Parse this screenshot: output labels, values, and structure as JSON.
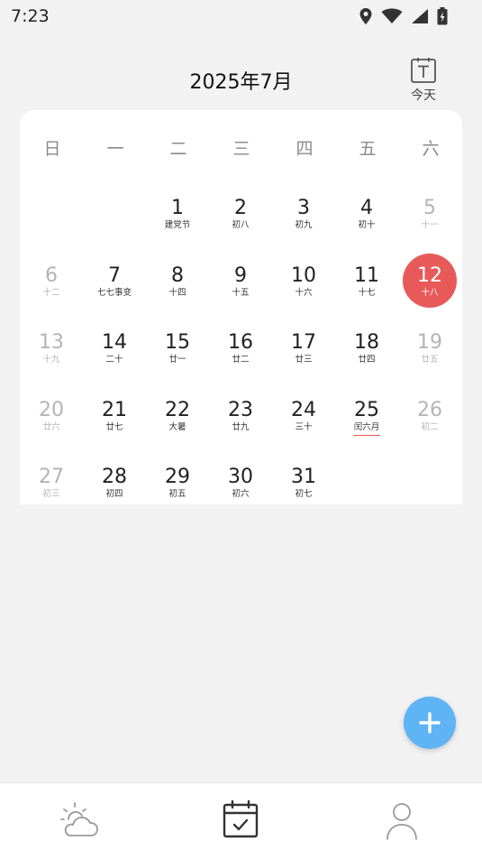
{
  "status_bar": {
    "time": "7:23",
    "icons": [
      "location-icon",
      "wifi-icon",
      "cell-signal-icon",
      "battery-charging-icon"
    ]
  },
  "header": {
    "title": "2025年7月",
    "today_label": "今天",
    "today_icon": "calendar-today-icon"
  },
  "weekdays": [
    "日",
    "一",
    "二",
    "三",
    "四",
    "五",
    "六"
  ],
  "colors": {
    "accent_red": "#e85a5a",
    "fab_blue": "#5fb4f5",
    "weekend_gray": "#b4b4b4"
  },
  "days": [
    {
      "day": "1",
      "lunar": "建党节"
    },
    {
      "day": "2",
      "lunar": "初八"
    },
    {
      "day": "3",
      "lunar": "初九"
    },
    {
      "day": "4",
      "lunar": "初十"
    },
    {
      "day": "5",
      "lunar": "十一"
    },
    {
      "day": "6",
      "lunar": "十二"
    },
    {
      "day": "7",
      "lunar": "七七事变"
    },
    {
      "day": "8",
      "lunar": "十四"
    },
    {
      "day": "9",
      "lunar": "十五"
    },
    {
      "day": "10",
      "lunar": "十六"
    },
    {
      "day": "11",
      "lunar": "十七"
    },
    {
      "day": "12",
      "lunar": "十八",
      "selected": true
    },
    {
      "day": "13",
      "lunar": "十九"
    },
    {
      "day": "14",
      "lunar": "二十"
    },
    {
      "day": "15",
      "lunar": "廿一"
    },
    {
      "day": "16",
      "lunar": "廿二"
    },
    {
      "day": "17",
      "lunar": "廿三"
    },
    {
      "day": "18",
      "lunar": "廿四"
    },
    {
      "day": "19",
      "lunar": "廿五"
    },
    {
      "day": "20",
      "lunar": "廿六"
    },
    {
      "day": "21",
      "lunar": "廿七"
    },
    {
      "day": "22",
      "lunar": "大暑"
    },
    {
      "day": "23",
      "lunar": "廿九"
    },
    {
      "day": "24",
      "lunar": "三十"
    },
    {
      "day": "25",
      "lunar": "闰六月",
      "underlined": true
    },
    {
      "day": "26",
      "lunar": "初二"
    },
    {
      "day": "27",
      "lunar": "初三"
    },
    {
      "day": "28",
      "lunar": "初四"
    },
    {
      "day": "29",
      "lunar": "初五"
    },
    {
      "day": "30",
      "lunar": "初六"
    },
    {
      "day": "31",
      "lunar": "初七"
    }
  ],
  "fab": {
    "icon": "plus-icon"
  },
  "bottom_nav": [
    {
      "name": "weather",
      "icon": "weather-icon"
    },
    {
      "name": "calendar",
      "icon": "calendar-check-icon",
      "active": true
    },
    {
      "name": "profile",
      "icon": "user-icon"
    }
  ]
}
